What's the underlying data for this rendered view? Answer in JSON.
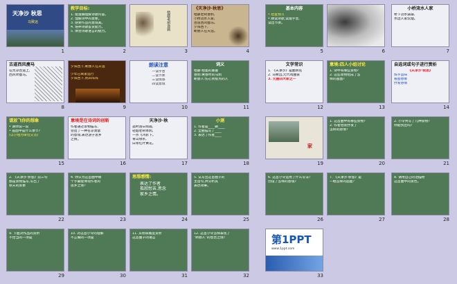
{
  "slides": [
    {
      "n": "1",
      "title": "天净沙 秋思",
      "sub": "马致远"
    },
    {
      "n": "2",
      "title": "教学目标:",
      "lines": [
        "1. 能准确理解诗歌内容。",
        "2. 理解诗中的意象。",
        "3. 感受作品的意境美。",
        "4. 培养诗歌鉴赏能力。",
        "5. 体会诗歌语言的魅力。"
      ]
    },
    {
      "n": "3",
      "lines": [
        "枯藤老树昏鸦",
        "小桥流水人家",
        "古道西风瘦马"
      ]
    },
    {
      "n": "4",
      "title": "《天净沙·秋思》",
      "lines": [
        "枯藤老树昏鸦,",
        "小桥流水人家,",
        "古道西风瘦马。",
        "夕阳西下,",
        "断肠人在天涯。"
      ]
    },
    {
      "n": "5",
      "title": "基本内容",
      "lines": [
        "• 检查预习",
        "• 朗读诗歌,读准字音,",
        "  读出节奏。"
      ]
    },
    {
      "n": "6"
    },
    {
      "n": "7",
      "title": "小桥流水人家",
      "lines": [
        "桥下流水潺潺,",
        "水边人家炊烟。"
      ]
    },
    {
      "n": "8",
      "title": "古道西风瘦马",
      "lines": [
        "在荒凉古道上,",
        "西风吹瘦马。"
      ]
    },
    {
      "n": "9",
      "lines": [
        "夕阳西下,断肠人在天涯",
        "少年已离家远行",
        "夕阳西下,鸦声阵阵"
      ]
    },
    {
      "n": "10",
      "title": "朗读注意",
      "lines": [
        "一读字音",
        "二读节奏",
        "三读情感",
        "四读意境"
      ]
    },
    {
      "n": "11",
      "title": "词义",
      "lines": [
        "枯藤:枯萎的藤蔓",
        "昏鸦:黄昏时的乌鸦",
        "断肠人:伤心到极点的人"
      ]
    },
    {
      "n": "12",
      "title": "文学常识",
      "lines": [
        "1. 《天净沙》是曲牌名",
        "2. 马致远,元代戏曲家",
        "3. 元曲四大家之一"
      ]
    },
    {
      "n": "13",
      "title": "意境:四人小组讨论",
      "lines": [
        "1. 诗中有哪些景物?",
        "2. 这些景物组成了怎",
        "   样的画面?"
      ]
    },
    {
      "n": "14",
      "title": "自选词或句子进行赏析",
      "lines": [
        "《天净沙·秋思》",
        "炼字品味",
        "看图想象",
        "抒发感情"
      ]
    },
    {
      "n": "15",
      "title": "请放飞你的想象",
      "lines": [
        "• 请你说一说",
        "• 画面中是什么季节?",
        "(以小组为单位交流)"
      ]
    },
    {
      "n": "16",
      "title": "意境是在诗词的创新",
      "lines": [
        "作者通过景物描写,",
        "营造了一种苍凉萧瑟",
        "的意境,表达游子思乡",
        "之情。"
      ]
    },
    {
      "n": "17",
      "title": "天净沙·秋",
      "lines": [
        "孤村落日残霞,",
        "轻烟老树寒鸦,",
        "一点飞鸿影下。",
        "青山绿水,",
        "白草红叶黄花。"
      ]
    },
    {
      "n": "18",
      "title": "小测",
      "lines": [
        "1. 作者是____朝____",
        "2. 全曲描写了____",
        "3. 表达了作者____"
      ]
    },
    {
      "n": "19",
      "lines": [
        "家"
      ]
    },
    {
      "n": "20",
      "lines": [
        "1. 这首曲中有哪些景物?",
        "2. 作者借景抒发了",
        "   怎样的感情?"
      ]
    },
    {
      "n": "21",
      "lines": [
        "2. 小令共写了几种景物?",
        "   你能找出吗?"
      ]
    },
    {
      "n": "22",
      "lines": [
        "2. 《天净沙·秋思》前三句",
        "都是景物描写,写出了",
        "秋天的景象"
      ]
    },
    {
      "n": "23",
      "lines": [
        "4. 你认为这首曲中哪",
        "个字最能体现作者的",
        "思乡之情?"
      ]
    },
    {
      "n": "24",
      "title": "思想感情:",
      "lines": [
        "表达了作者",
        "孤寂愁苦,思念",
        "家乡之情。"
      ]
    },
    {
      "n": "25",
      "lines": [
        "5. 试写出这首曲子的",
        "主旨句,并分析其",
        "表达效果。"
      ]
    },
    {
      "n": "26",
      "lines": [
        "6. 这首小令运用了什么写法?",
        "创设了怎样的意境?"
      ]
    },
    {
      "n": "27",
      "lines": [
        "7. 《天净沙·秋思》是",
        "一幅怎样的画面?"
      ]
    },
    {
      "n": "28",
      "lines": [
        "8. 请用自己的话描绘",
        "这首曲中的景色。"
      ]
    },
    {
      "n": "29",
      "lines": [
        "9. 下面对作品的赏析",
        "不恰当的一项是"
      ]
    },
    {
      "n": "30",
      "lines": [
        "10. 对这首小令的理解",
        "不正确的一项是"
      ]
    },
    {
      "n": "31",
      "lines": [
        "11. 从修辞角度赏析",
        "这首曲子的语言"
      ]
    },
    {
      "n": "32",
      "lines": [
        "12. 这首小令怎样表现了",
        "\"断肠人\"的愁苦之情?"
      ]
    },
    {
      "n": "33",
      "logo": "第1PPT",
      "sub": "www.1ppt.com"
    }
  ]
}
